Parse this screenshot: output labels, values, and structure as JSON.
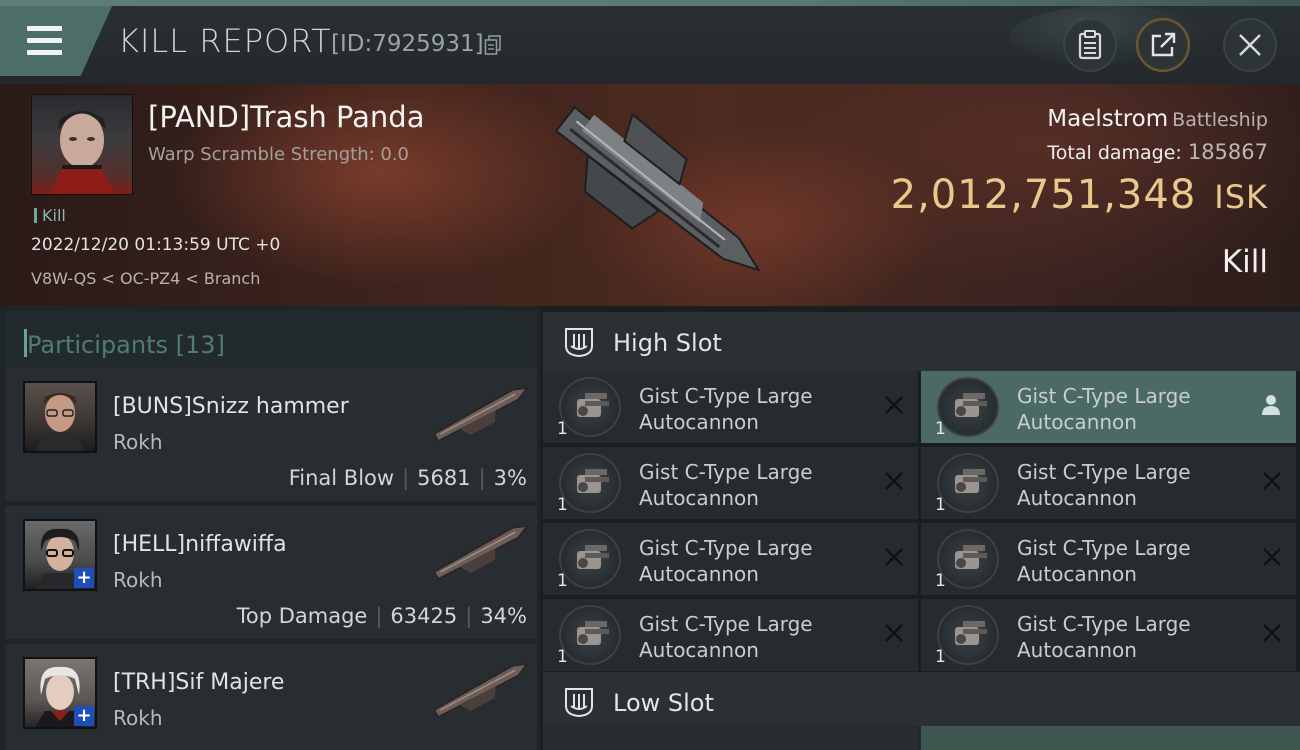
{
  "window": {
    "title": "KILL REPORT",
    "report_id": "[ID:7925931]"
  },
  "victim": {
    "name": "[PAND]Trash Panda",
    "warp_scramble": "Warp Scramble Strength: 0.0",
    "tag": "Kill",
    "time": "2022/12/20 01:13:59 UTC +0",
    "location": "V8W-QS < OC-PZ4 < Branch",
    "ship": "Maelstrom",
    "ship_class": "Battleship",
    "total_damage_label": "Total damage:",
    "total_damage_value": "185867",
    "isk_value": "2,012,751,348",
    "isk_unit": "ISK",
    "result": "Kill"
  },
  "participants": {
    "label": "Participants [13]",
    "items": [
      {
        "name": "[BUNS]Snizz hammer",
        "ship": "Rokh",
        "role": "Final Blow",
        "damage": "5681",
        "percent": "3%"
      },
      {
        "name": "[HELL]niffawiffa",
        "ship": "Rokh",
        "role": "Top Damage",
        "damage": "63425",
        "percent": "34%"
      },
      {
        "name": "[TRH]Sif Majere",
        "ship": "Rokh"
      }
    ]
  },
  "slots": {
    "high_label": "High Slot",
    "low_label": "Low Slot",
    "high_modules": [
      {
        "line1": "Gist C-Type Large",
        "line2": "Autocannon",
        "qty": "1",
        "status": "destroyed"
      },
      {
        "line1": "Gist C-Type Large",
        "line2": "Autocannon",
        "qty": "1",
        "status": "dropped"
      },
      {
        "line1": "Gist C-Type Large",
        "line2": "Autocannon",
        "qty": "1",
        "status": "destroyed"
      },
      {
        "line1": "Gist C-Type Large",
        "line2": "Autocannon",
        "qty": "1",
        "status": "destroyed"
      },
      {
        "line1": "Gist C-Type Large",
        "line2": "Autocannon",
        "qty": "1",
        "status": "destroyed"
      },
      {
        "line1": "Gist C-Type Large",
        "line2": "Autocannon",
        "qty": "1",
        "status": "destroyed"
      },
      {
        "line1": "Gist C-Type Large",
        "line2": "Autocannon",
        "qty": "1",
        "status": "destroyed"
      },
      {
        "line1": "Gist C-Type Large",
        "line2": "Autocannon",
        "qty": "1",
        "status": "destroyed"
      }
    ]
  },
  "colors": {
    "accent_teal": "#4d6e68",
    "isk_gold": "#e9c98b",
    "plus_badge": "#1f4fb6"
  }
}
